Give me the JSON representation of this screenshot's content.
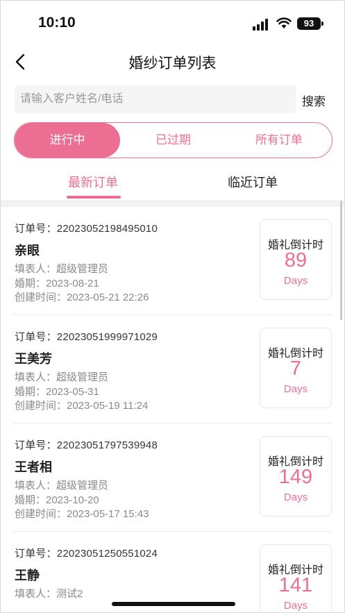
{
  "status": {
    "time": "10:10",
    "battery": "93"
  },
  "nav": {
    "title": "婚纱订单列表"
  },
  "search": {
    "placeholder": "请输入客户姓名/电话",
    "button_label": "搜索"
  },
  "segments": [
    {
      "label": "进行中",
      "active": true
    },
    {
      "label": "已过期",
      "active": false
    },
    {
      "label": "所有订单",
      "active": false
    }
  ],
  "tabs": [
    {
      "label": "最新订单",
      "active": true
    },
    {
      "label": "临近订单",
      "active": false
    }
  ],
  "countdown_label": "婚礼倒计时",
  "countdown_unit": "Days",
  "orders": [
    {
      "order_no": "订单号：22023052198495010",
      "name": "亲眼",
      "filler": "填表人：超级管理员",
      "wedding_date": "婚期：2023-08-21",
      "created": "创建时间：2023-05-21 22:26",
      "days": "89"
    },
    {
      "order_no": "订单号：22023051999971029",
      "name": "王美芳",
      "filler": "填表人：超级管理员",
      "wedding_date": "婚期：2023-05-31",
      "created": "创建时间：2023-05-19 11:24",
      "days": "7"
    },
    {
      "order_no": "订单号：22023051797539948",
      "name": "王者相",
      "filler": "填表人：超级管理员",
      "wedding_date": "婚期：2023-10-20",
      "created": "创建时间：2023-05-17 15:43",
      "days": "149"
    },
    {
      "order_no": "订单号：22023051250551024",
      "name": "王静",
      "filler": "填表人：测试2",
      "wedding_date": "",
      "created": "",
      "days": "141"
    }
  ],
  "colors": {
    "accent": "#ec6f93",
    "text": "#222222",
    "muted": "#8a8a8a"
  }
}
